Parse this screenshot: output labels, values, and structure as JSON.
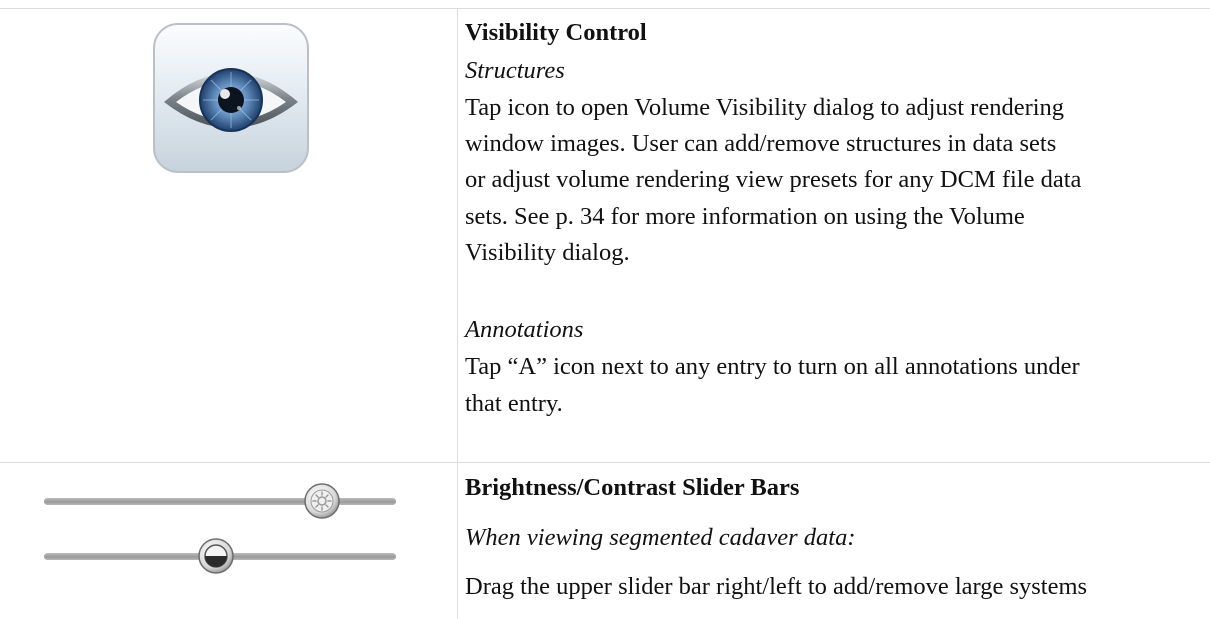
{
  "visibility": {
    "title": "Visibility Control",
    "structures_heading": "Structures",
    "structures_lines": [
      "Tap icon to open Volume Visibility dialog to adjust rendering",
      "window images.  User can add/remove structures in data sets",
      "or adjust volume rendering view presets for any DCM file data",
      "sets.  See p. 34 for more information on using the Volume",
      "Visibility dialog."
    ],
    "annotations_heading": "Annotations",
    "annotations_lines": [
      "Tap “A” icon next to any entry to turn on all annotations under",
      "that entry."
    ],
    "icon": "eye-icon"
  },
  "brightness": {
    "title": "Brightness/Contrast Slider Bars",
    "subtitle": "When viewing segmented cadaver data:",
    "body_line": "Drag the upper slider bar right/left to add/remove large systems",
    "sliders": [
      {
        "name": "brightness",
        "icon": "sun-icon",
        "level_percent": 79
      },
      {
        "name": "contrast",
        "icon": "contrast-icon",
        "level_percent": 49
      }
    ]
  }
}
